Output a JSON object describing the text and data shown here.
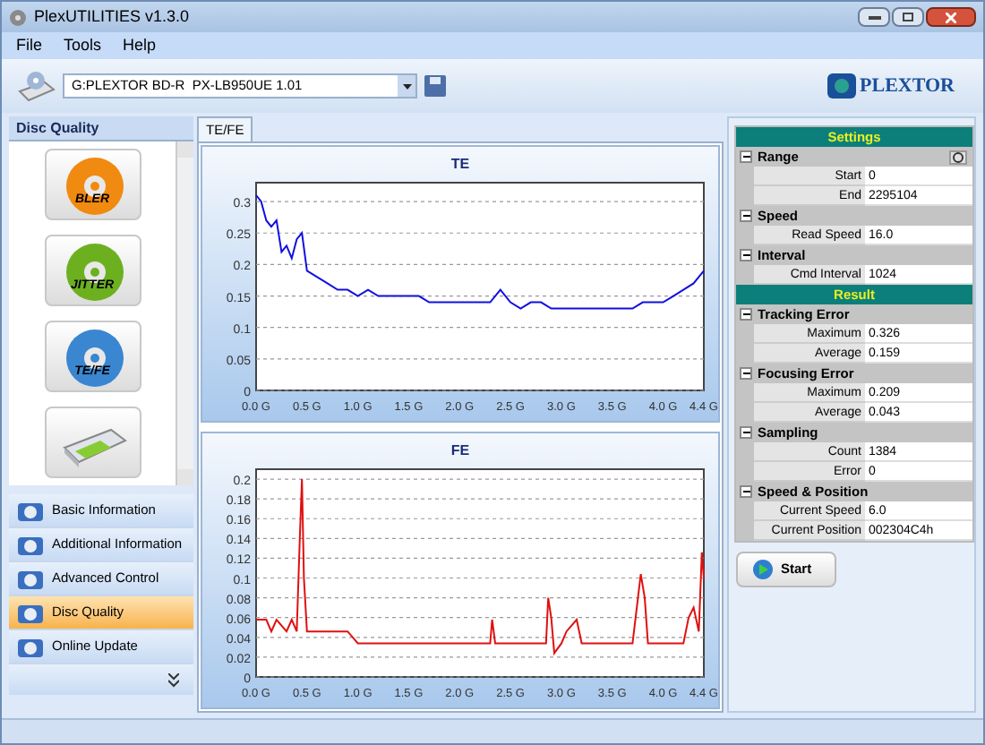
{
  "window": {
    "title": "PlexUTILITIES v1.3.0"
  },
  "menu": [
    "File",
    "Tools",
    "Help"
  ],
  "drive": {
    "value": "G:PLEXTOR BD-R  PX-LB950UE 1.01"
  },
  "logo": "PLEXTOR",
  "sidebar": {
    "title": "Disc Quality",
    "tests": [
      {
        "label": "BLER",
        "kind": "disc",
        "color": "#f08a10"
      },
      {
        "label": "JITTER",
        "kind": "disc",
        "color": "#6cb020"
      },
      {
        "label": "TE/FE",
        "kind": "disc",
        "color": "#3a86d0"
      },
      {
        "kind": "drive"
      }
    ],
    "nav": [
      {
        "label": "Basic Information",
        "selected": false
      },
      {
        "label": "Additional Information",
        "selected": false
      },
      {
        "label": "Advanced Control",
        "selected": false
      },
      {
        "label": "Disc Quality",
        "selected": true
      },
      {
        "label": "Online Update",
        "selected": false
      }
    ]
  },
  "tabs": [
    {
      "label": "TE/FE",
      "selected": true
    }
  ],
  "charts": [
    {
      "chart_data": {
        "type": "line",
        "title": "TE",
        "x": [
          0,
          0.05,
          0.1,
          0.15,
          0.2,
          0.25,
          0.3,
          0.35,
          0.4,
          0.45,
          0.5,
          0.6,
          0.7,
          0.8,
          0.9,
          1.0,
          1.1,
          1.2,
          1.3,
          1.4,
          1.5,
          1.6,
          1.7,
          1.8,
          1.9,
          2.0,
          2.1,
          2.2,
          2.3,
          2.4,
          2.5,
          2.6,
          2.7,
          2.8,
          2.9,
          3.0,
          3.1,
          3.2,
          3.3,
          3.4,
          3.5,
          3.6,
          3.7,
          3.8,
          3.9,
          4.0,
          4.1,
          4.2,
          4.3,
          4.4
        ],
        "series": [
          {
            "color": "#1010e0",
            "values": [
              0.31,
              0.3,
              0.27,
              0.26,
              0.27,
              0.22,
              0.23,
              0.21,
              0.24,
              0.25,
              0.19,
              0.18,
              0.17,
              0.16,
              0.16,
              0.15,
              0.16,
              0.15,
              0.15,
              0.15,
              0.15,
              0.15,
              0.14,
              0.14,
              0.14,
              0.14,
              0.14,
              0.14,
              0.14,
              0.16,
              0.14,
              0.13,
              0.14,
              0.14,
              0.13,
              0.13,
              0.13,
              0.13,
              0.13,
              0.13,
              0.13,
              0.13,
              0.13,
              0.14,
              0.14,
              0.14,
              0.15,
              0.16,
              0.17,
              0.19
            ]
          }
        ],
        "xlim": [
          0,
          4.4
        ],
        "ylim": [
          0,
          0.33
        ],
        "grid": true,
        "xticks": [
          {
            "value": 0,
            "label": "0.0 G"
          },
          {
            "value": 0.5,
            "label": "0.5 G"
          },
          {
            "value": 1,
            "label": "1.0 G"
          },
          {
            "value": 1.5,
            "label": "1.5 G"
          },
          {
            "value": 2,
            "label": "2.0 G"
          },
          {
            "value": 2.5,
            "label": "2.5 G"
          },
          {
            "value": 3,
            "label": "3.0 G"
          },
          {
            "value": 3.5,
            "label": "3.5 G"
          },
          {
            "value": 4,
            "label": "4.0 G"
          },
          {
            "value": 4.4,
            "label": "4.4 G"
          }
        ],
        "yticks": [
          {
            "value": 0.3,
            "label": "0.3"
          },
          {
            "value": 0.25,
            "label": "0.25"
          },
          {
            "value": 0.2,
            "label": "0.2"
          },
          {
            "value": 0.15,
            "label": "0.15"
          },
          {
            "value": 0.1,
            "label": "0.1"
          },
          {
            "value": 0.05,
            "label": "0.05"
          },
          {
            "value": 0,
            "label": "0"
          }
        ]
      }
    },
    {
      "chart_data": {
        "type": "line",
        "title": "FE",
        "x": [
          0,
          0.1,
          0.15,
          0.2,
          0.3,
          0.35,
          0.4,
          0.43,
          0.45,
          0.47,
          0.5,
          0.9,
          0.95,
          1.0,
          1.7,
          2.3,
          2.32,
          2.35,
          2.5,
          2.85,
          2.87,
          2.9,
          2.93,
          3.0,
          3.05,
          3.15,
          3.2,
          3.7,
          3.78,
          3.82,
          3.85,
          3.9,
          4.0,
          4.2,
          4.25,
          4.3,
          4.35,
          4.38,
          4.4
        ],
        "series": [
          {
            "color": "#e01010",
            "values": [
              0.058,
              0.058,
              0.046,
              0.058,
              0.046,
              0.058,
              0.046,
              0.14,
              0.2,
              0.1,
              0.046,
              0.046,
              0.04,
              0.034,
              0.034,
              0.034,
              0.058,
              0.034,
              0.034,
              0.034,
              0.08,
              0.06,
              0.024,
              0.034,
              0.046,
              0.058,
              0.034,
              0.034,
              0.104,
              0.08,
              0.034,
              0.034,
              0.034,
              0.034,
              0.06,
              0.07,
              0.046,
              0.126,
              0.1
            ]
          }
        ],
        "xlim": [
          0,
          4.4
        ],
        "ylim": [
          0,
          0.21
        ],
        "grid": true,
        "xticks": [
          {
            "value": 0,
            "label": "0.0 G"
          },
          {
            "value": 0.5,
            "label": "0.5 G"
          },
          {
            "value": 1,
            "label": "1.0 G"
          },
          {
            "value": 1.5,
            "label": "1.5 G"
          },
          {
            "value": 2,
            "label": "2.0 G"
          },
          {
            "value": 2.5,
            "label": "2.5 G"
          },
          {
            "value": 3,
            "label": "3.0 G"
          },
          {
            "value": 3.5,
            "label": "3.5 G"
          },
          {
            "value": 4,
            "label": "4.0 G"
          },
          {
            "value": 4.4,
            "label": "4.4 G"
          }
        ],
        "yticks": [
          {
            "value": 0.2,
            "label": "0.2"
          },
          {
            "value": 0.18,
            "label": "0.18"
          },
          {
            "value": 0.16,
            "label": "0.16"
          },
          {
            "value": 0.14,
            "label": "0.14"
          },
          {
            "value": 0.12,
            "label": "0.12"
          },
          {
            "value": 0.1,
            "label": "0.1"
          },
          {
            "value": 0.08,
            "label": "0.08"
          },
          {
            "value": 0.06,
            "label": "0.06"
          },
          {
            "value": 0.04,
            "label": "0.04"
          },
          {
            "value": 0.02,
            "label": "0.02"
          },
          {
            "value": 0,
            "label": "0"
          }
        ]
      }
    }
  ],
  "panels": [
    {
      "title": "Settings",
      "groups": [
        {
          "title": "Range",
          "button": true,
          "rows": [
            {
              "label": "Start",
              "value": "0"
            },
            {
              "label": "End",
              "value": "2295104"
            }
          ]
        },
        {
          "title": "Speed",
          "rows": [
            {
              "label": "Read Speed",
              "value": "16.0"
            }
          ]
        },
        {
          "title": "Interval",
          "rows": [
            {
              "label": "Cmd Interval",
              "value": "1024"
            }
          ]
        }
      ]
    },
    {
      "title": "Result",
      "groups": [
        {
          "title": "Tracking Error",
          "rows": [
            {
              "label": "Maximum",
              "value": "0.326"
            },
            {
              "label": "Average",
              "value": "0.159"
            }
          ]
        },
        {
          "title": "Focusing Error",
          "rows": [
            {
              "label": "Maximum",
              "value": "0.209"
            },
            {
              "label": "Average",
              "value": "0.043"
            }
          ]
        },
        {
          "title": "Sampling",
          "rows": [
            {
              "label": "Count",
              "value": "1384"
            },
            {
              "label": "Error",
              "value": "0"
            }
          ]
        },
        {
          "title": "Speed & Position",
          "rows": [
            {
              "label": "Current Speed",
              "value": "6.0"
            },
            {
              "label": "Current Position",
              "value": "002304C4h"
            }
          ]
        }
      ]
    }
  ],
  "start_button": "Start"
}
